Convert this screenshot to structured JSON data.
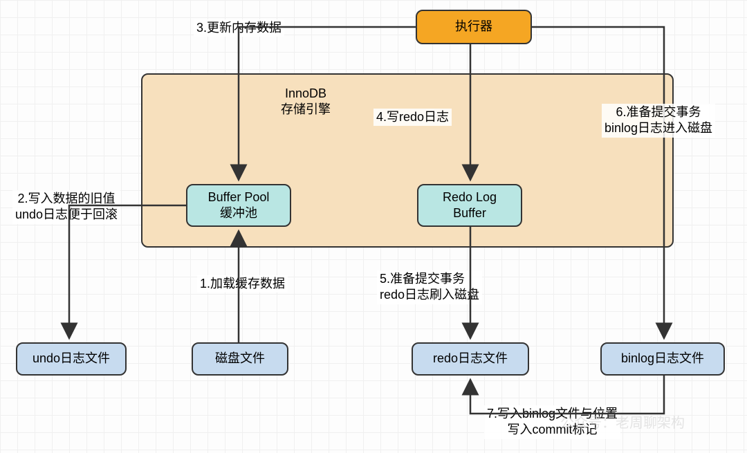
{
  "nodes": {
    "executor": "执行器",
    "innodb_title_l1": "InnoDB",
    "innodb_title_l2": "存储引擎",
    "buffer_pool_l1": "Buffer Pool",
    "buffer_pool_l2": "缓冲池",
    "redo_buffer_l1": "Redo Log",
    "redo_buffer_l2": "Buffer",
    "undo_file": "undo日志文件",
    "disk_file": "磁盘文件",
    "redo_file": "redo日志文件",
    "binlog_file": "binlog日志文件"
  },
  "labels": {
    "l1": "1.加载缓存数据",
    "l2": "2.写入数据的旧值\nundo日志便于回滚",
    "l3": "3.更新内存数据",
    "l4": "4.写redo日志",
    "l5": "5.准备提交事务\nredo日志刷入磁盘",
    "l6": "6.准备提交事务\nbinlog日志进入磁盘",
    "l7": "7.写入binlog文件与位置\n写入commit标记"
  },
  "watermark": "公众号：老周聊架构"
}
